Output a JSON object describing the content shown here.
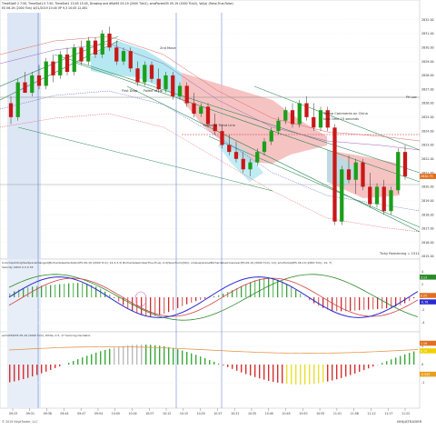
{
  "header": {
    "line1": "TimeSlot5 2   7:50, TimeSlot1-5  7:50, TimeSlot1 13:45  15:45, Drawing and dflat95 05-19 (2000 Tick2), smoPocket35 05-19 (2000 Tick2), Vol(a) (False,True,False)",
    "line2": "ES 06-19 (2000 Tick)   4/01/2019  10:45  VP 9,3 10:45  12,461"
  },
  "annotations": {
    "second_move": "2nd Move",
    "first_drop": "First Drop",
    "failed_at_trend_line_1": "Failed at up",
    "failed_at_trend_line_2": "Failed at Trend Line",
    "trump": "Trump Comments on China",
    "trump_sub": "total time 15 seconds",
    "tick_remaining": "Ticky Remaining = 1511",
    "ph_low": "PH Low"
  },
  "price_axis": {
    "ticks": [
      "2832.00",
      "2831.00",
      "2830.00",
      "2829.00",
      "2828.00",
      "2827.00",
      "2826.00",
      "2825.00",
      "2824.00",
      "2823.00",
      "2822.00",
      "2821.00",
      "2820.00",
      "2819.00",
      "2818.00",
      "2817.00",
      "2816.00",
      "2815.00"
    ],
    "current_price": "2820.75"
  },
  "panel2": {
    "title": "ColorInputOnlyDevSpaceChanged(BorhardelseOscillator(ES 06-19 (2000 Tick), 14,3,3,3) BorhardelseIndex(True,True), 0.0(Spectrum)(Sto), smaLaplanlowBorhardelseCrossover(ES 06-19 (2000 Tick), 14), smoPocket(ES 06-19 (2000 Tick), 14, 7)",
    "subtitle": "Velocity  CDC0 0 0 0 35",
    "axis_ticks": [
      "4",
      "2",
      "0",
      "-2",
      "-4"
    ],
    "value_tags": [
      "3.13",
      "0.25",
      "-0.76"
    ]
  },
  "panel3": {
    "title": "extraTRIX35 05-19 (2000 Tick), White, 0.5, 17 Samring Oscillator",
    "axis_ticks": [
      "1",
      "0",
      "-1"
    ],
    "value_tags": [
      "1.16",
      "0.74",
      "-0.543"
    ]
  },
  "time_axis": [
    "09:23",
    "09:31",
    "09:38",
    "09:44",
    "09:47",
    "09:54",
    "10:00",
    "10:04",
    "10:07",
    "10:12",
    "10:15",
    "10:20",
    "10:27",
    "10:31",
    "10:35",
    "10:40",
    "10:45",
    "10:50",
    "10:55",
    "11:01",
    "11:06",
    "11:12",
    "11:17",
    "11:22"
  ],
  "footer": {
    "copyright": "© 2019 NinjaTrader, LLC",
    "brand": "NINJATRADER"
  },
  "colors": {
    "bull": "#1a9f1a",
    "bear": "#c81818",
    "trend": "#2e8b57",
    "pink_zone": "#f4b8b8",
    "cyan_zone": "#a8e4ef",
    "blue_shade": "#dde6f4",
    "osc_line": "#2a2ad0",
    "red_line": "#d04040"
  },
  "chart_data": {
    "type": "candlestick",
    "symbol": "ES 06-19 (2000 Tick)",
    "ylim": [
      2815.0,
      2832.5
    ],
    "candles": [
      {
        "o": 2826.0,
        "h": 2826.5,
        "l": 2824.5,
        "c": 2825.0
      },
      {
        "o": 2825.0,
        "h": 2827.75,
        "l": 2824.75,
        "c": 2827.5
      },
      {
        "o": 2827.5,
        "h": 2828.25,
        "l": 2826.75,
        "c": 2826.75
      },
      {
        "o": 2826.75,
        "h": 2828.25,
        "l": 2826.5,
        "c": 2828.0
      },
      {
        "o": 2828.0,
        "h": 2828.75,
        "l": 2827.0,
        "c": 2827.25
      },
      {
        "o": 2827.25,
        "h": 2829.25,
        "l": 2827.0,
        "c": 2829.0
      },
      {
        "o": 2829.0,
        "h": 2829.5,
        "l": 2827.5,
        "c": 2828.0
      },
      {
        "o": 2828.0,
        "h": 2829.75,
        "l": 2827.75,
        "c": 2829.5
      },
      {
        "o": 2829.5,
        "h": 2830.0,
        "l": 2828.0,
        "c": 2828.25
      },
      {
        "o": 2828.25,
        "h": 2830.25,
        "l": 2828.0,
        "c": 2830.0
      },
      {
        "o": 2830.0,
        "h": 2830.5,
        "l": 2828.75,
        "c": 2829.0
      },
      {
        "o": 2829.0,
        "h": 2830.75,
        "l": 2828.75,
        "c": 2830.5
      },
      {
        "o": 2830.5,
        "h": 2830.75,
        "l": 2829.25,
        "c": 2829.5
      },
      {
        "o": 2829.5,
        "h": 2831.25,
        "l": 2829.25,
        "c": 2831.0
      },
      {
        "o": 2831.0,
        "h": 2831.5,
        "l": 2829.75,
        "c": 2830.0
      },
      {
        "o": 2830.0,
        "h": 2830.5,
        "l": 2828.75,
        "c": 2829.0
      },
      {
        "o": 2829.0,
        "h": 2830.0,
        "l": 2828.75,
        "c": 2829.75
      },
      {
        "o": 2829.75,
        "h": 2830.0,
        "l": 2828.25,
        "c": 2828.5
      },
      {
        "o": 2828.5,
        "h": 2829.0,
        "l": 2827.25,
        "c": 2827.5
      },
      {
        "o": 2827.5,
        "h": 2829.0,
        "l": 2827.25,
        "c": 2828.75
      },
      {
        "o": 2828.75,
        "h": 2829.0,
        "l": 2827.5,
        "c": 2827.75
      },
      {
        "o": 2827.75,
        "h": 2828.5,
        "l": 2826.75,
        "c": 2827.0
      },
      {
        "o": 2827.0,
        "h": 2828.25,
        "l": 2826.75,
        "c": 2828.0
      },
      {
        "o": 2828.0,
        "h": 2828.25,
        "l": 2826.25,
        "c": 2826.5
      },
      {
        "o": 2826.5,
        "h": 2827.5,
        "l": 2826.25,
        "c": 2827.25
      },
      {
        "o": 2827.25,
        "h": 2827.5,
        "l": 2825.75,
        "c": 2826.0
      },
      {
        "o": 2826.0,
        "h": 2826.75,
        "l": 2825.0,
        "c": 2825.25
      },
      {
        "o": 2825.25,
        "h": 2826.0,
        "l": 2825.0,
        "c": 2825.75
      },
      {
        "o": 2825.75,
        "h": 2826.0,
        "l": 2824.25,
        "c": 2824.5
      },
      {
        "o": 2824.5,
        "h": 2825.25,
        "l": 2823.75,
        "c": 2824.0
      },
      {
        "o": 2824.0,
        "h": 2824.5,
        "l": 2822.75,
        "c": 2823.0
      },
      {
        "o": 2823.0,
        "h": 2823.75,
        "l": 2822.25,
        "c": 2822.5
      },
      {
        "o": 2822.5,
        "h": 2823.25,
        "l": 2821.75,
        "c": 2822.0
      },
      {
        "o": 2822.0,
        "h": 2822.5,
        "l": 2821.0,
        "c": 2821.25
      },
      {
        "o": 2821.25,
        "h": 2822.0,
        "l": 2820.75,
        "c": 2821.75
      },
      {
        "o": 2821.75,
        "h": 2822.75,
        "l": 2821.5,
        "c": 2822.5
      },
      {
        "o": 2822.5,
        "h": 2823.5,
        "l": 2822.25,
        "c": 2823.25
      },
      {
        "o": 2823.25,
        "h": 2824.25,
        "l": 2823.0,
        "c": 2824.0
      },
      {
        "o": 2824.0,
        "h": 2825.0,
        "l": 2823.75,
        "c": 2824.75
      },
      {
        "o": 2824.75,
        "h": 2825.75,
        "l": 2824.5,
        "c": 2825.5
      },
      {
        "o": 2825.5,
        "h": 2826.0,
        "l": 2824.25,
        "c": 2824.5
      },
      {
        "o": 2824.5,
        "h": 2826.25,
        "l": 2824.25,
        "c": 2826.0
      },
      {
        "o": 2826.0,
        "h": 2826.5,
        "l": 2824.75,
        "c": 2825.0
      },
      {
        "o": 2825.0,
        "h": 2826.0,
        "l": 2824.0,
        "c": 2824.25
      },
      {
        "o": 2824.25,
        "h": 2825.75,
        "l": 2824.0,
        "c": 2825.5
      },
      {
        "o": 2825.5,
        "h": 2825.75,
        "l": 2824.0,
        "c": 2824.25
      },
      {
        "o": 2824.25,
        "h": 2824.5,
        "l": 2817.25,
        "c": 2817.5
      },
      {
        "o": 2817.5,
        "h": 2821.5,
        "l": 2817.25,
        "c": 2821.25
      },
      {
        "o": 2821.25,
        "h": 2822.25,
        "l": 2820.25,
        "c": 2820.5
      },
      {
        "o": 2820.5,
        "h": 2822.0,
        "l": 2819.5,
        "c": 2821.75
      },
      {
        "o": 2821.75,
        "h": 2822.0,
        "l": 2819.75,
        "c": 2820.0
      },
      {
        "o": 2820.0,
        "h": 2821.0,
        "l": 2818.5,
        "c": 2818.75
      },
      {
        "o": 2818.75,
        "h": 2820.25,
        "l": 2818.5,
        "c": 2820.0
      },
      {
        "o": 2820.0,
        "h": 2820.5,
        "l": 2818.0,
        "c": 2818.25
      },
      {
        "o": 2818.25,
        "h": 2820.0,
        "l": 2818.0,
        "c": 2819.75
      },
      {
        "o": 2819.75,
        "h": 2822.75,
        "l": 2819.5,
        "c": 2822.5
      },
      {
        "o": 2822.5,
        "h": 2823.0,
        "l": 2820.5,
        "c": 2820.75
      }
    ]
  }
}
